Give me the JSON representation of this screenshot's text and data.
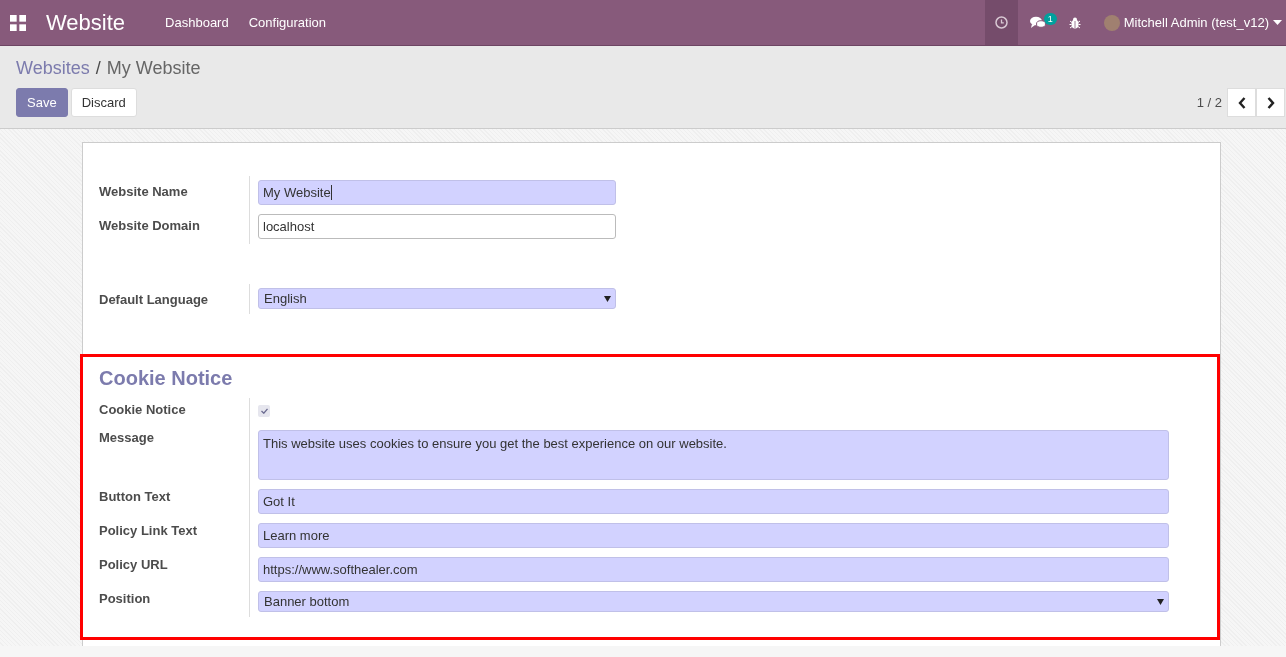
{
  "navbar": {
    "app_name": "Website",
    "menu": [
      "Dashboard",
      "Configuration"
    ],
    "activity_active": true,
    "chat_badge": "1",
    "user": "Mitchell Admin (test_v12)"
  },
  "breadcrumb": {
    "parent": "Websites",
    "separator": "/",
    "current": "My Website"
  },
  "buttons": [
    {
      "label": "Save",
      "kind": "primary"
    },
    {
      "label": "Discard",
      "kind": "secondary"
    }
  ],
  "pager": {
    "text": "1 / 2"
  },
  "groups": [
    {
      "fields": [
        {
          "label": "Website Name",
          "kind": "input",
          "value": "My Website",
          "required": true,
          "focused": true
        },
        {
          "label": "Website Domain",
          "kind": "input",
          "value": "localhost",
          "required": false
        }
      ]
    },
    {
      "fields": [
        {
          "label": "Default Language",
          "kind": "select",
          "value": "English",
          "required": true
        }
      ]
    }
  ],
  "cookie_section": {
    "title": "Cookie Notice",
    "highlighted": true,
    "fields": [
      {
        "label": "Cookie Notice",
        "kind": "checkbox",
        "checked": true
      },
      {
        "label": "Message",
        "kind": "textarea",
        "value": "This website uses cookies to ensure you get the best experience on our website.",
        "required": true
      },
      {
        "label": "Button Text",
        "kind": "input",
        "value": "Got It",
        "required": true
      },
      {
        "label": "Policy Link Text",
        "kind": "input",
        "value": "Learn more",
        "required": true
      },
      {
        "label": "Policy URL",
        "kind": "input",
        "value": "https://www.softhealer.com",
        "required": true
      },
      {
        "label": "Position",
        "kind": "select",
        "value": "Banner bottom",
        "required": true
      }
    ]
  }
}
